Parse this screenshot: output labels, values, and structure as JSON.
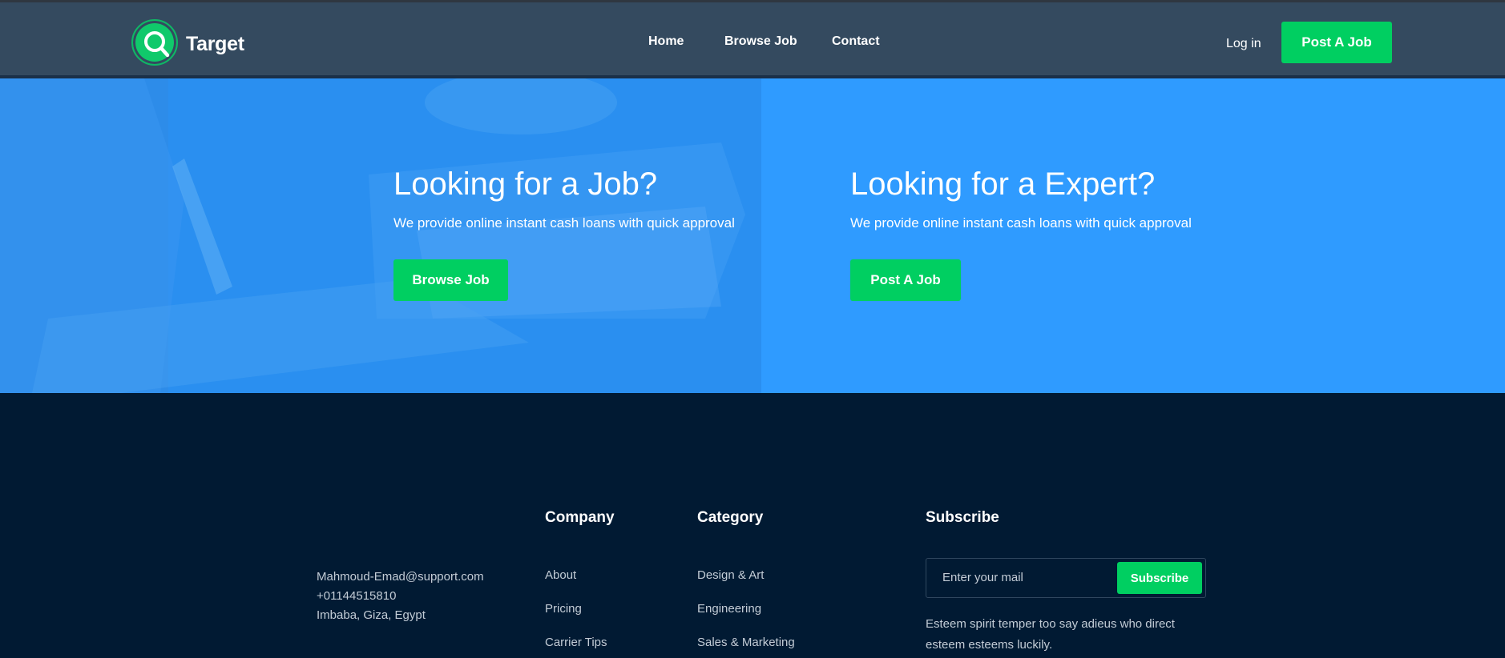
{
  "brand": {
    "name": "Target",
    "accent": "#00cf61",
    "header_bg": "#344a5f",
    "hero_bg": "#2f9bff",
    "footer_bg": "#011a33"
  },
  "nav": {
    "home": "Home",
    "browse_job": "Browse Job",
    "contact": "Contact",
    "login": "Log in",
    "post_job": "Post A Job"
  },
  "hero": {
    "left": {
      "title": "Looking for a Job?",
      "subtitle": "We provide online instant cash loans with quick approval",
      "button": "Browse Job"
    },
    "right": {
      "title": "Looking for a Expert?",
      "subtitle": "We provide online instant cash loans with quick approval",
      "button": "Post A Job"
    }
  },
  "footer": {
    "contact": {
      "email": "Mahmoud-Emad@support.com",
      "phone": "+01144515810",
      "address": "Imbaba, Giza, Egypt"
    },
    "company": {
      "title": "Company",
      "links": [
        "About",
        "Pricing",
        "Carrier Tips"
      ]
    },
    "category": {
      "title": "Category",
      "links": [
        "Design & Art",
        "Engineering",
        "Sales & Marketing"
      ]
    },
    "subscribe": {
      "title": "Subscribe",
      "placeholder": "Enter your mail",
      "button": "Subscribe",
      "text": "Esteem spirit temper too say adieus who direct esteem esteems luckily."
    }
  },
  "icons": {
    "logo": "search-icon"
  }
}
